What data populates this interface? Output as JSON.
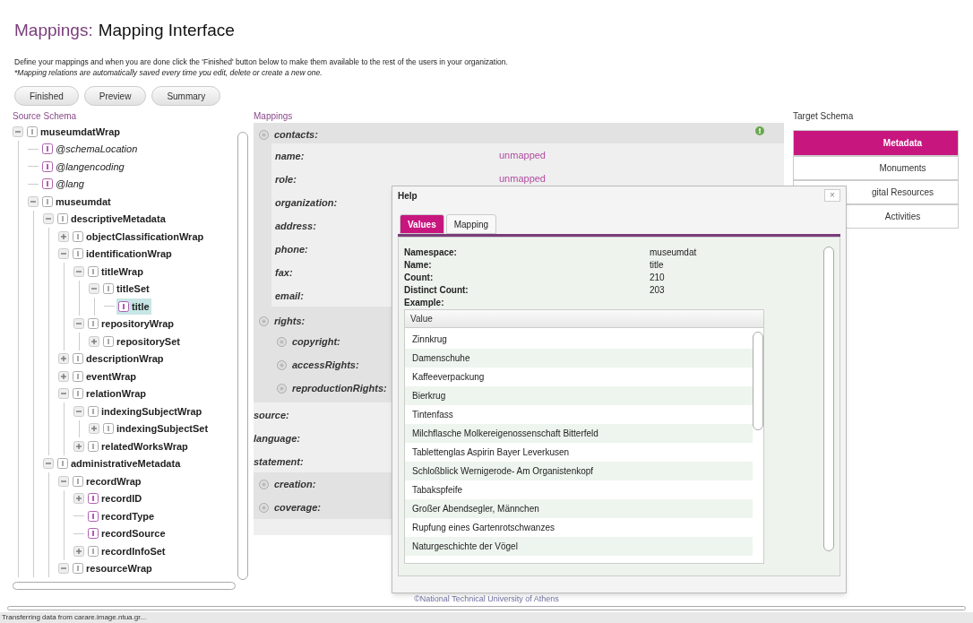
{
  "page_title": {
    "section": "Mappings:",
    "title": "Mapping Interface"
  },
  "intro": {
    "text": "Define your mappings and when you are done click the 'Finished' button below to make them available to the rest of the users in your organization.",
    "note": "*Mapping relations are automatically saved every time you edit, delete or create a new one."
  },
  "buttons": [
    "Finished",
    "Preview",
    "Summary"
  ],
  "source_schema": {
    "heading": "Source Schema",
    "tree": [
      {
        "label": "museumdatWrap",
        "kind": "element",
        "expanded": true,
        "selected": false,
        "children": [
          {
            "label": "@schemaLocation",
            "kind": "attribute",
            "selected": false
          },
          {
            "label": "@langencoding",
            "kind": "attribute",
            "selected": false
          },
          {
            "label": "@lang",
            "kind": "attribute",
            "selected": false
          },
          {
            "label": "museumdat",
            "kind": "element",
            "expanded": true,
            "selected": false,
            "children": [
              {
                "label": "descriptiveMetadata",
                "kind": "element",
                "expanded": true,
                "selected": false,
                "children": [
                  {
                    "label": "objectClassificationWrap",
                    "kind": "element",
                    "expanded": false,
                    "selected": false
                  },
                  {
                    "label": "identificationWrap",
                    "kind": "element",
                    "expanded": true,
                    "selected": false,
                    "children": [
                      {
                        "label": "titleWrap",
                        "kind": "element",
                        "expanded": true,
                        "selected": false,
                        "children": [
                          {
                            "label": "titleSet",
                            "kind": "element",
                            "expanded": true,
                            "selected": false,
                            "children": [
                              {
                                "label": "title",
                                "kind": "text",
                                "selected": true
                              }
                            ]
                          }
                        ]
                      },
                      {
                        "label": "repositoryWrap",
                        "kind": "element",
                        "expanded": true,
                        "selected": false,
                        "children": [
                          {
                            "label": "repositorySet",
                            "kind": "element",
                            "expanded": false,
                            "selected": false
                          }
                        ]
                      }
                    ]
                  },
                  {
                    "label": "descriptionWrap",
                    "kind": "element",
                    "expanded": false,
                    "selected": false
                  },
                  {
                    "label": "eventWrap",
                    "kind": "element",
                    "expanded": false,
                    "selected": false
                  },
                  {
                    "label": "relationWrap",
                    "kind": "element",
                    "expanded": true,
                    "selected": false,
                    "children": [
                      {
                        "label": "indexingSubjectWrap",
                        "kind": "element",
                        "expanded": true,
                        "selected": false,
                        "children": [
                          {
                            "label": "indexingSubjectSet",
                            "kind": "element",
                            "expanded": false,
                            "selected": false
                          }
                        ]
                      },
                      {
                        "label": "relatedWorksWrap",
                        "kind": "element",
                        "expanded": false,
                        "selected": false
                      }
                    ]
                  }
                ]
              },
              {
                "label": "administrativeMetadata",
                "kind": "element",
                "expanded": true,
                "selected": false,
                "children": [
                  {
                    "label": "recordWrap",
                    "kind": "element",
                    "expanded": true,
                    "selected": false,
                    "children": [
                      {
                        "label": "recordID",
                        "kind": "text",
                        "expanded": false,
                        "selected": false
                      },
                      {
                        "label": "recordType",
                        "kind": "text",
                        "selected": false
                      },
                      {
                        "label": "recordSource",
                        "kind": "text",
                        "selected": false
                      },
                      {
                        "label": "recordInfoSet",
                        "kind": "element",
                        "expanded": false,
                        "selected": false
                      }
                    ]
                  },
                  {
                    "label": "resourceWrap",
                    "kind": "element",
                    "expanded": true,
                    "selected": false
                  }
                ]
              }
            ]
          }
        ]
      }
    ]
  },
  "mappings": {
    "heading": "Mappings",
    "items": [
      {
        "kind": "section",
        "label": "contacts:",
        "children": [
          {
            "kind": "field",
            "label": "name:",
            "value": "unmapped"
          },
          {
            "kind": "field",
            "label": "role:",
            "value": "unmapped"
          },
          {
            "kind": "field",
            "label": "organization:"
          },
          {
            "kind": "field",
            "label": "address:"
          },
          {
            "kind": "field",
            "label": "phone:"
          },
          {
            "kind": "field",
            "label": "fax:"
          },
          {
            "kind": "field",
            "label": "email:"
          }
        ]
      },
      {
        "kind": "section",
        "label": "rights:",
        "children": [
          {
            "kind": "section",
            "label": "copyright:"
          },
          {
            "kind": "section",
            "label": "accessRights:"
          },
          {
            "kind": "section",
            "label": "reproductionRights:"
          }
        ]
      },
      {
        "kind": "field",
        "label": "source:"
      },
      {
        "kind": "field",
        "label": "language:"
      },
      {
        "kind": "field",
        "label": "statement:"
      },
      {
        "kind": "section",
        "label": "creation:"
      },
      {
        "kind": "section",
        "label": "coverage:"
      }
    ]
  },
  "target_schema": {
    "heading": "Target Schema",
    "items": [
      {
        "label": "Metadata",
        "selected": true
      },
      {
        "label": "Monuments",
        "selected": false
      },
      {
        "label": "gital Resources",
        "selected": false
      },
      {
        "label": "Activities",
        "selected": false
      }
    ]
  },
  "help_dialog": {
    "title": "Help",
    "close": "×",
    "tabs": [
      {
        "label": "Values",
        "selected": true
      },
      {
        "label": "Mapping",
        "selected": false
      }
    ],
    "info": [
      {
        "label": "Namespace:",
        "value": "museumdat"
      },
      {
        "label": "Name:",
        "value": "title"
      },
      {
        "label": "Count:",
        "value": "210"
      },
      {
        "label": "Distinct Count:",
        "value": "203"
      }
    ],
    "example_label": "Example:",
    "table": {
      "columns": [
        "Value"
      ],
      "rows": [
        "Zinnkrug",
        "Damenschuhe",
        "Kaffeeverpackung",
        "Bierkrug",
        "Tintenfass",
        "Milchflasche Molkereigenossenschaft Bitterfeld",
        "Tablettenglas Aspirin Bayer Leverkusen",
        "Schloßblick Wernigerode- Am Organistenkopf",
        "Tabakspfeife",
        "Großer Abendsegler, Männchen",
        "Rupfung eines Gartenrotschwanzes",
        "Naturgeschichte der Vögel"
      ]
    }
  },
  "footer": "©National Technical University of Athens",
  "status_bar": "Transferring data from carare.image.ntua.gr..."
}
